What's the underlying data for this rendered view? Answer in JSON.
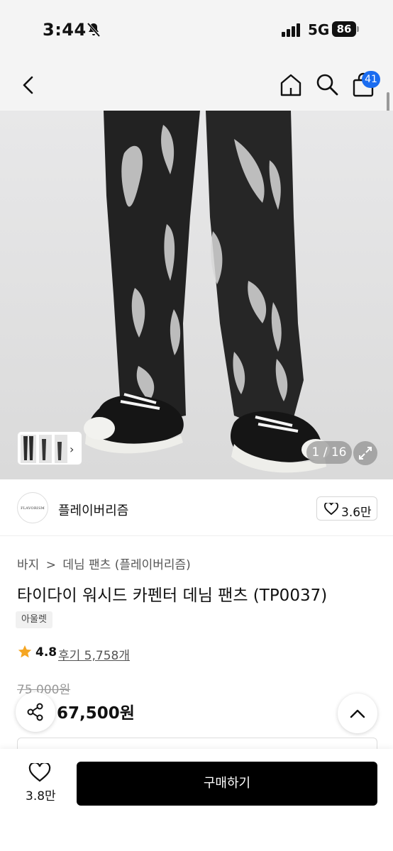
{
  "status_bar": {
    "time": "3:44",
    "network": "5G",
    "battery": "86",
    "icons": [
      "bell-slash-icon",
      "signal-icon",
      "battery-icon"
    ]
  },
  "nav": {
    "icons": [
      "chevron-left-icon",
      "home-icon",
      "search-icon",
      "shopping-bag-icon"
    ],
    "cart_badge": "41"
  },
  "gallery": {
    "page_indicator": "1 / 16",
    "icons": [
      "chevron-right-icon",
      "expand-icon"
    ]
  },
  "brand": {
    "logo_text": "FLAVORISM",
    "name": "플레이버리즘",
    "like_count": "3.6만",
    "icons": [
      "heart-outline-icon"
    ]
  },
  "product": {
    "breadcrumb": [
      "바지",
      ">",
      "데님 팬츠 (플레이버리즘)"
    ],
    "title": "타이다이 워시드 카펜터 데님 팬츠 (TP0037)",
    "tag": "아울렛",
    "rating": "4.8",
    "review_text": "후기 5,758개",
    "original_price": "75,000원",
    "sale_price": "67,500원"
  },
  "floating": {
    "icons": [
      "share-icon",
      "chevron-up-icon"
    ]
  },
  "bottom_bar": {
    "wish_count": "3.8만",
    "buy_label": "구매하기",
    "icons": [
      "heart-outline-icon"
    ]
  },
  "colors": {
    "accent": "#1a6cf0",
    "buy_button": "#000000",
    "star": "#f5a623"
  }
}
